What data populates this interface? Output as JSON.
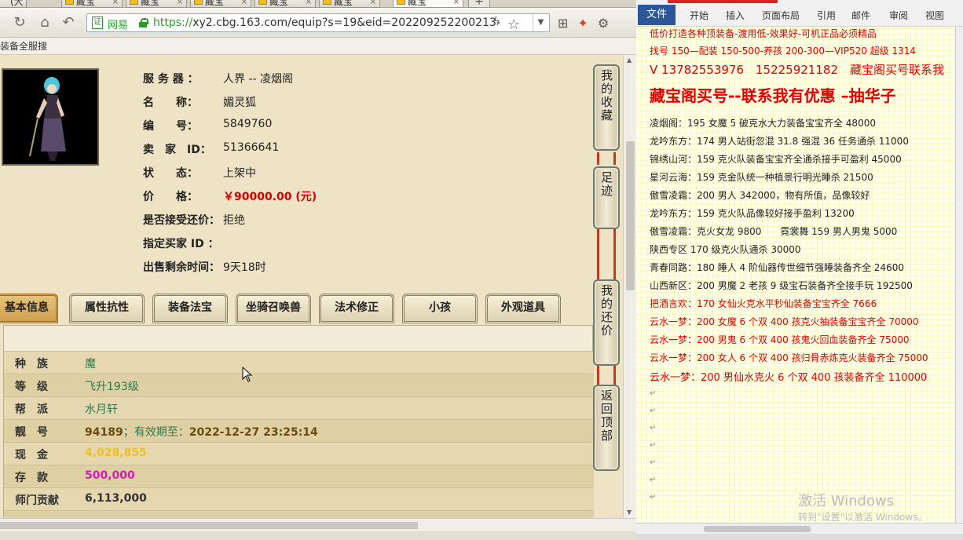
{
  "browser": {
    "tabs": [
      "(大",
      "藏宝",
      "藏宝",
      "藏宝",
      "藏宝",
      "藏宝",
      "藏宝"
    ],
    "url_site_label": "网易",
    "url_scheme": "https://",
    "url_rest": "xy2.cbg.163.com/equip?s=19&eid=202209252200213-",
    "bookmark_text": "装备全服搜"
  },
  "character": {
    "rows": [
      {
        "label": "服 务 器 ：",
        "value": "人界 -- 凌烟阁"
      },
      {
        "label": "名　　称：",
        "value": "媚灵狐"
      },
      {
        "label": "编　　号：",
        "value": "5849760"
      },
      {
        "label": "卖　家　ID：",
        "value": "51366641"
      },
      {
        "label": "状　　态：",
        "value": "上架中"
      },
      {
        "label": "价　　格：",
        "value": "￥90000.00 (元)"
      },
      {
        "label": "是否接受还价：",
        "value": "拒绝"
      },
      {
        "label": "指定买家 ID ：",
        "value": ""
      },
      {
        "label": "出售剩余时间：",
        "value": "9天18时"
      }
    ]
  },
  "side_buttons": [
    "我的收藏",
    "足迹",
    "我的还价",
    "返回顶部"
  ],
  "game_tabs": [
    "基本信息",
    "属性抗性",
    "装备法宝",
    "坐骑召唤兽",
    "法术修正",
    "小孩",
    "外观道具"
  ],
  "attributes": [
    {
      "label": "种　族",
      "value": "魔"
    },
    {
      "label": "等　级",
      "value": "飞升193级"
    },
    {
      "label": "帮　派",
      "value": "水月轩"
    },
    {
      "label": "靓　号",
      "value": "94189",
      "extra": "；有效期至：",
      "date": "2022-12-27 23:25:14"
    },
    {
      "label": "现　金",
      "value": "4,028,855"
    },
    {
      "label": "存　款",
      "value": "500,000"
    },
    {
      "label": "师门贡献",
      "value": "6,113,000"
    },
    {
      "label": "",
      "value": ""
    }
  ],
  "word": {
    "file_tab": "文件",
    "ribbon_tabs": [
      "开始",
      "插入",
      "页面布局",
      "引用",
      "邮件",
      "审阅",
      "视图"
    ],
    "lines": [
      "低价打造各种顶装备-渡用低-效果好-可机正品必须精品",
      "找号 150—配装 150-500-养孩 200-300—VIP520 超级 1314",
      "V 13782553976　15225921182　藏宝阁买号联系我",
      "藏宝阁买号--联系我有优惠 –抽华子",
      "凌烟阁：195 女魔 5 破克水大力装备宝宝齐全 48000",
      "龙吟东方：174 男人站街忽混 31.8 强混 36 任务通杀 11000",
      "锦绣山河：159 克火队装备宝宝齐全通杀接手可盈利 45000",
      "星河云海：159 克金队统一种植景行明光睡杀 21500",
      "傲雪凌霜：200 男人 342000，物有所值，品像较好",
      "龙吟东方：159 克火队品像较好接手盈利 13200",
      "傲雪凌霜：克火女龙 9800　　霓裳舞 159 男人男鬼 5000",
      "陕西专区 170 级克火队通杀 30000",
      "青春同路：180 睡人 4 阶仙器传世细节强睡装备齐全 24600",
      "山西新区：200 男魔 2 老孩 9 级宝石装备齐全接手玩 192500",
      "把酒言欢：170 女仙火克水平秒仙装备宝宝齐全 7666",
      "云水一梦：200 女魔 6 个双 400 孩克火抽装备宝宝齐全 70000",
      "云水一梦：200 男鬼 6 个双 400 孩鬼火回血装备齐全 75000",
      "云水一梦：200 女人 6 个双 400 孩归骨赤炼克火装备齐全 75000",
      "云水一梦：200 男仙水克火 6 个双 400 孩装备齐全 110000"
    ],
    "watermark_1": "激活 Windows",
    "watermark_2": "转到\"设置\"以激活 Windows。"
  },
  "colors": {
    "price_red": "#d00000",
    "doc_red": "#e00000",
    "word_blue": "#2b579a"
  }
}
